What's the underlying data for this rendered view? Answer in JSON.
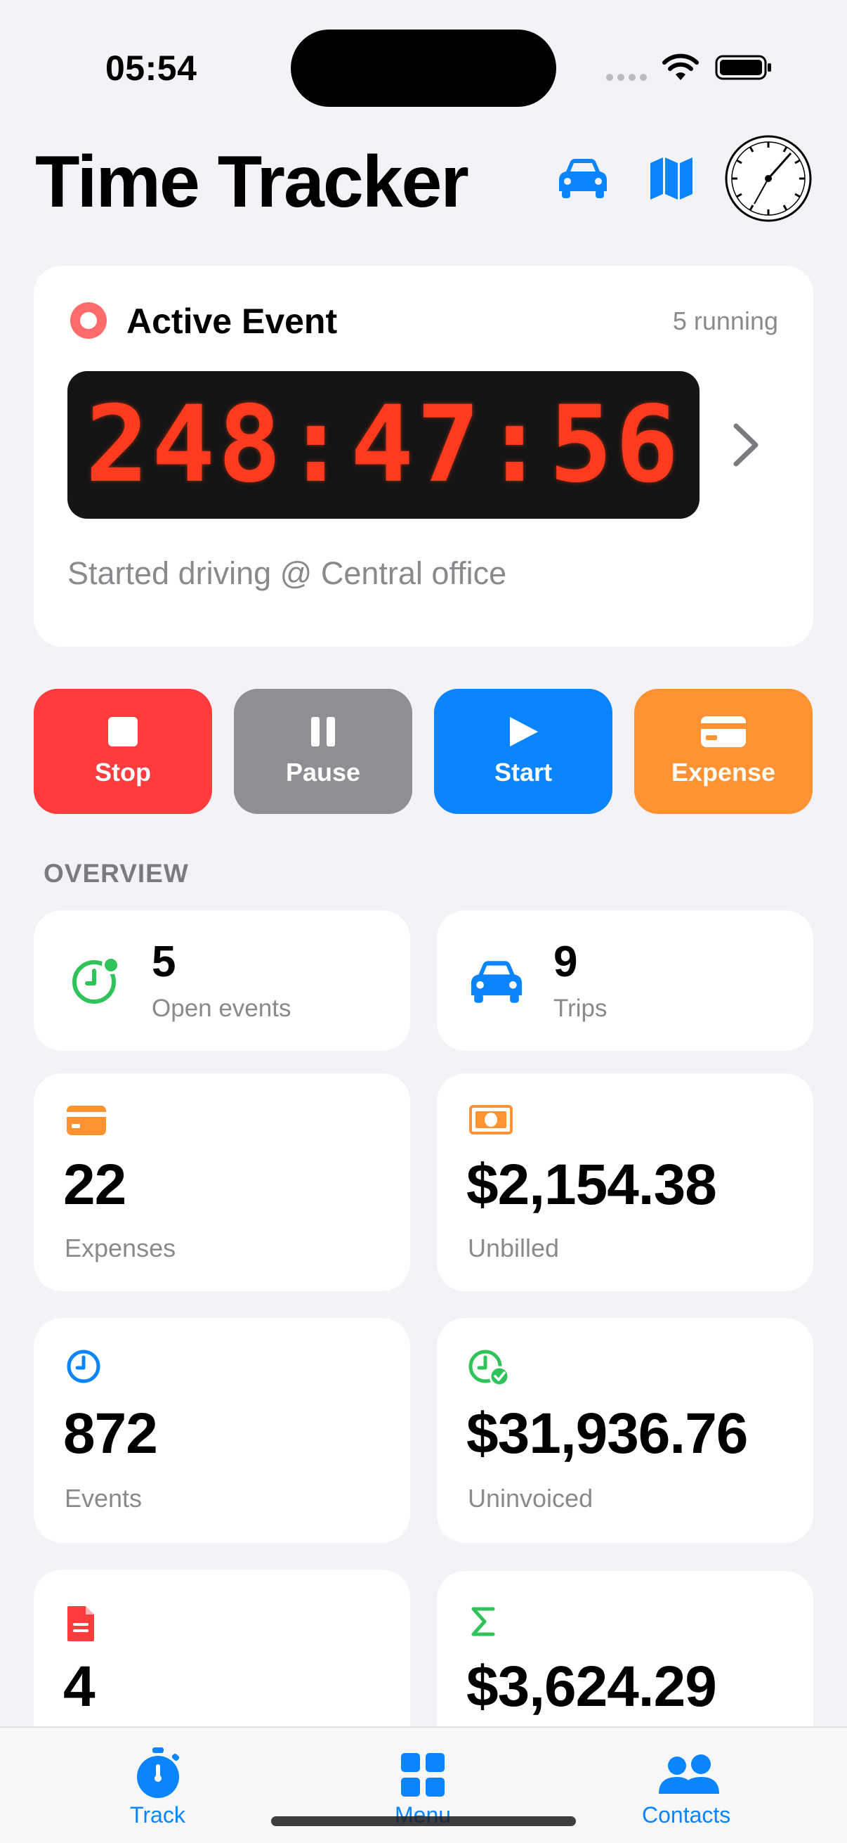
{
  "status_bar": {
    "time": "05:54"
  },
  "header": {
    "title": "Time Tracker"
  },
  "active_event": {
    "label": "Active Event",
    "running": "5 running",
    "timer": "248:47:56",
    "description": "Started driving @ Central office"
  },
  "actions": {
    "stop": "Stop",
    "pause": "Pause",
    "start": "Start",
    "expense": "Expense"
  },
  "overview": {
    "heading": "OVERVIEW",
    "open_events": {
      "value": "5",
      "label": "Open events"
    },
    "trips": {
      "value": "9",
      "label": "Trips"
    },
    "expenses": {
      "value": "22",
      "label": "Expenses"
    },
    "unbilled": {
      "value": "$2,154.38",
      "label": "Unbilled"
    },
    "events": {
      "value": "872",
      "label": "Events"
    },
    "uninvoiced": {
      "value": "$31,936.76",
      "label": "Uninvoiced"
    },
    "documents": {
      "value": "4"
    },
    "total": {
      "value": "$3,624.29"
    }
  },
  "tabs": {
    "track": "Track",
    "menu": "Menu",
    "contacts": "Contacts"
  },
  "colors": {
    "blue": "#0a84ff",
    "red": "#fe3b3d",
    "gray": "#8e8e93",
    "orange": "#ff9233",
    "green": "#30c35a",
    "lcd_red": "#ff3b1f"
  }
}
